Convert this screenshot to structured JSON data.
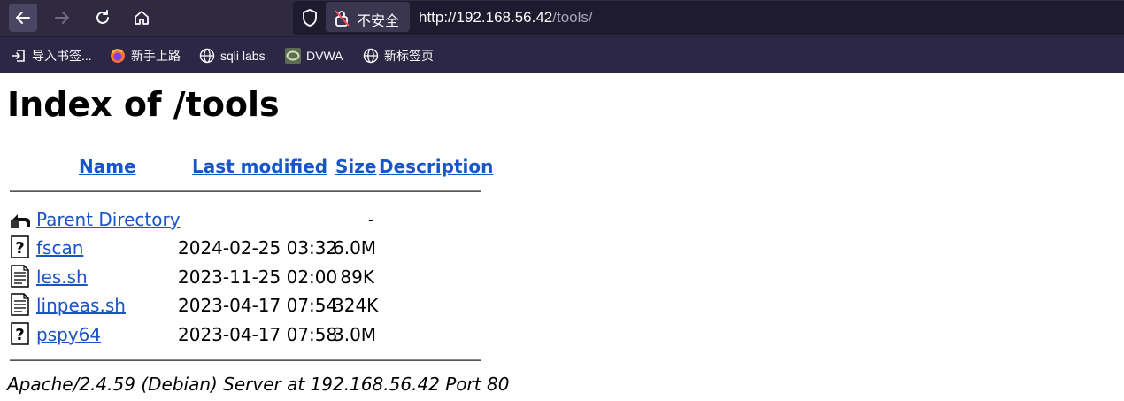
{
  "browser": {
    "security_label": "不安全",
    "url_host": "http://192.168.56.42",
    "url_path": "/tools/",
    "bookmarks": [
      {
        "label": "导入书签...",
        "icon": "import-icon"
      },
      {
        "label": "新手上路",
        "icon": "firefox-icon"
      },
      {
        "label": "sqli labs",
        "icon": "globe-icon"
      },
      {
        "label": "DVWA",
        "icon": "dvwa-icon"
      },
      {
        "label": "新标签页",
        "icon": "globe-icon"
      }
    ]
  },
  "page": {
    "title": "Index of /tools",
    "columns": {
      "name": "Name",
      "modified": "Last modified",
      "size": "Size",
      "description": "Description"
    },
    "rows": [
      {
        "name": "Parent Directory",
        "modified": "",
        "size": "-",
        "icon": "back-folder-icon"
      },
      {
        "name": "fscan",
        "modified": "2024-02-25 03:32",
        "size": "6.0M",
        "icon": "unknown-file-icon"
      },
      {
        "name": "les.sh",
        "modified": "2023-11-25 02:00",
        "size": "89K",
        "icon": "text-file-icon"
      },
      {
        "name": "linpeas.sh",
        "modified": "2023-04-17 07:54",
        "size": "324K",
        "icon": "text-file-icon"
      },
      {
        "name": "pspy64",
        "modified": "2023-04-17 07:58",
        "size": "3.0M",
        "icon": "unknown-file-icon"
      }
    ],
    "footer": "Apache/2.4.59 (Debian) Server at 192.168.56.42 Port 80"
  }
}
